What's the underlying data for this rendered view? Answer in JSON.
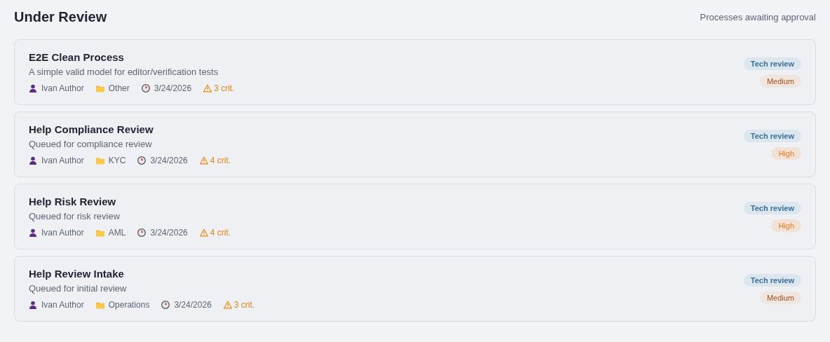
{
  "header": {
    "title": "Under Review",
    "subtitle": "Processes awaiting approval"
  },
  "processes": [
    {
      "name": "E2E Clean Process",
      "description": "A simple valid model for editor/verification tests",
      "author": "Ivan Author",
      "category": "Other",
      "date": "3/24/2026",
      "criticals": "3 crit.",
      "stage": "Tech review",
      "priority": {
        "label": "Medium",
        "kind": "medium"
      }
    },
    {
      "name": "Help Compliance Review",
      "description": "Queued for compliance review",
      "author": "Ivan Author",
      "category": "KYC",
      "date": "3/24/2026",
      "criticals": "4 crit.",
      "stage": "Tech review",
      "priority": {
        "label": "High",
        "kind": "high"
      }
    },
    {
      "name": "Help Risk Review",
      "description": "Queued for risk review",
      "author": "Ivan Author",
      "category": "AML",
      "date": "3/24/2026",
      "criticals": "4 crit.",
      "stage": "Tech review",
      "priority": {
        "label": "High",
        "kind": "high"
      }
    },
    {
      "name": "Help Review Intake",
      "description": "Queued for initial review",
      "author": "Ivan Author",
      "category": "Operations",
      "date": "3/24/2026",
      "criticals": "3 crit.",
      "stage": "Tech review",
      "priority": {
        "label": "Medium",
        "kind": "medium"
      }
    }
  ]
}
